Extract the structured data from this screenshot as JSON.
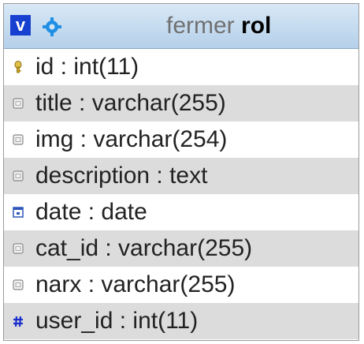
{
  "table": {
    "toggle": "v",
    "title_prefix": "fermer",
    "title_name": "rol",
    "gear_icon": "gear-icon",
    "columns": [
      {
        "text": "id : int(11)",
        "icon": "key-icon"
      },
      {
        "text": "title : varchar(255)",
        "icon": "text-field-icon"
      },
      {
        "text": "img : varchar(254)",
        "icon": "text-field-icon"
      },
      {
        "text": "description : text",
        "icon": "text-field-icon"
      },
      {
        "text": "date : date",
        "icon": "calendar-icon"
      },
      {
        "text": "cat_id : varchar(255)",
        "icon": "text-field-icon"
      },
      {
        "text": "narx : varchar(255)",
        "icon": "text-field-icon"
      },
      {
        "text": "user_id : int(11)",
        "icon": "number-icon"
      }
    ]
  },
  "colors": {
    "header_bg": "#c3daf0",
    "toggle_bg": "#1740d0",
    "alt_row_bg": "#dcdcdc",
    "title_prefix": "#707070",
    "number_icon": "#1a2fcc"
  }
}
